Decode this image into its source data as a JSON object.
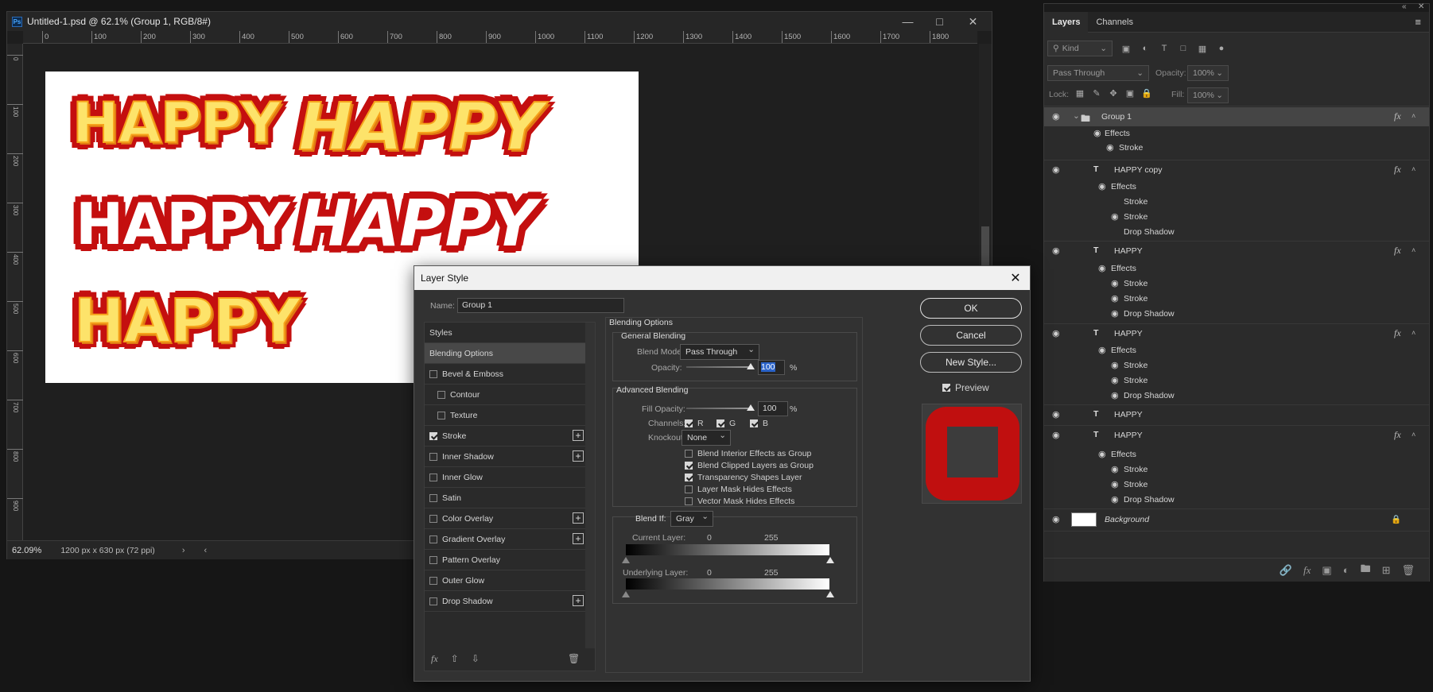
{
  "document": {
    "title": "Untitled-1.psd @ 62.1% (Group 1, RGB/8#)",
    "app_icon": "Ps",
    "ruler_top": [
      "0",
      "100",
      "200",
      "300",
      "400",
      "500",
      "600",
      "700",
      "800",
      "900",
      "1000",
      "1100",
      "1200",
      "1300",
      "1400",
      "1500",
      "1600",
      "1700",
      "1800"
    ],
    "ruler_left": [
      "0",
      "100",
      "200",
      "300",
      "400",
      "500",
      "600",
      "700",
      "800",
      "900"
    ],
    "canvas_words": [
      "HAPPY",
      "HAPPY",
      "HAPPY",
      "HAPPY",
      "HAPPY"
    ],
    "zoom": "62.09%",
    "doc_info": "1200 px x 630 px (72 ppi)"
  },
  "layers_panel": {
    "tabs": [
      "Layers",
      "Channels"
    ],
    "kind_filter": "Kind",
    "blend_mode": "Pass Through",
    "opacity_label": "Opacity:",
    "opacity_value": "100%",
    "lock_label": "Lock:",
    "fill_label": "Fill:",
    "fill_value": "100%",
    "rows": [
      {
        "label": "Group 1"
      },
      {
        "label": "Effects"
      },
      {
        "label": "Stroke"
      },
      {
        "label": "HAPPY copy"
      },
      {
        "label": "Effects"
      },
      {
        "label": "Stroke"
      },
      {
        "label": "Stroke"
      },
      {
        "label": "Drop Shadow"
      },
      {
        "label": "HAPPY"
      },
      {
        "label": "Effects"
      },
      {
        "label": "Stroke"
      },
      {
        "label": "Stroke"
      },
      {
        "label": "Drop Shadow"
      },
      {
        "label": "HAPPY"
      },
      {
        "label": "Effects"
      },
      {
        "label": "Stroke"
      },
      {
        "label": "Stroke"
      },
      {
        "label": "Drop Shadow"
      },
      {
        "label": "HAPPY"
      },
      {
        "label": "HAPPY"
      },
      {
        "label": "Effects"
      },
      {
        "label": "Stroke"
      },
      {
        "label": "Stroke"
      },
      {
        "label": "Drop Shadow"
      },
      {
        "label": "Background"
      }
    ],
    "fx": "fx"
  },
  "dialog": {
    "title": "Layer Style",
    "name_label": "Name:",
    "name_value": "Group 1",
    "styles": [
      {
        "label": "Styles"
      },
      {
        "label": "Blending Options"
      },
      {
        "label": "Bevel & Emboss"
      },
      {
        "label": "Contour"
      },
      {
        "label": "Texture"
      },
      {
        "label": "Stroke"
      },
      {
        "label": "Inner Shadow"
      },
      {
        "label": "Inner Glow"
      },
      {
        "label": "Satin"
      },
      {
        "label": "Color Overlay"
      },
      {
        "label": "Gradient Overlay"
      },
      {
        "label": "Pattern Overlay"
      },
      {
        "label": "Outer Glow"
      },
      {
        "label": "Drop Shadow"
      }
    ],
    "section_title": "Blending Options",
    "general_blending": "General Blending",
    "blend_mode_label": "Blend Mode:",
    "blend_mode_value": "Pass Through",
    "opacity_label": "Opacity:",
    "opacity_value": "100",
    "percent": "%",
    "advanced_blending": "Advanced Blending",
    "fill_opacity_label": "Fill Opacity:",
    "fill_opacity_value": "100",
    "channels_label": "Channels:",
    "channels": [
      "R",
      "G",
      "B"
    ],
    "knockout_label": "Knockout:",
    "knockout_value": "None",
    "options": [
      {
        "label": "Blend Interior Effects as Group",
        "checked": false
      },
      {
        "label": "Blend Clipped Layers as Group",
        "checked": true
      },
      {
        "label": "Transparency Shapes Layer",
        "checked": true
      },
      {
        "label": "Layer Mask Hides Effects",
        "checked": false
      },
      {
        "label": "Vector Mask Hides Effects",
        "checked": false
      }
    ],
    "blend_if_label": "Blend If:",
    "blend_if_value": "Gray",
    "current_layer_label": "Current Layer:",
    "underlying_layer_label": "Underlying Layer:",
    "range_min": "0",
    "range_max": "255",
    "buttons": {
      "ok": "OK",
      "cancel": "Cancel",
      "new_style": "New Style...",
      "preview": "Preview"
    },
    "preview_color": "#c00f0f"
  }
}
